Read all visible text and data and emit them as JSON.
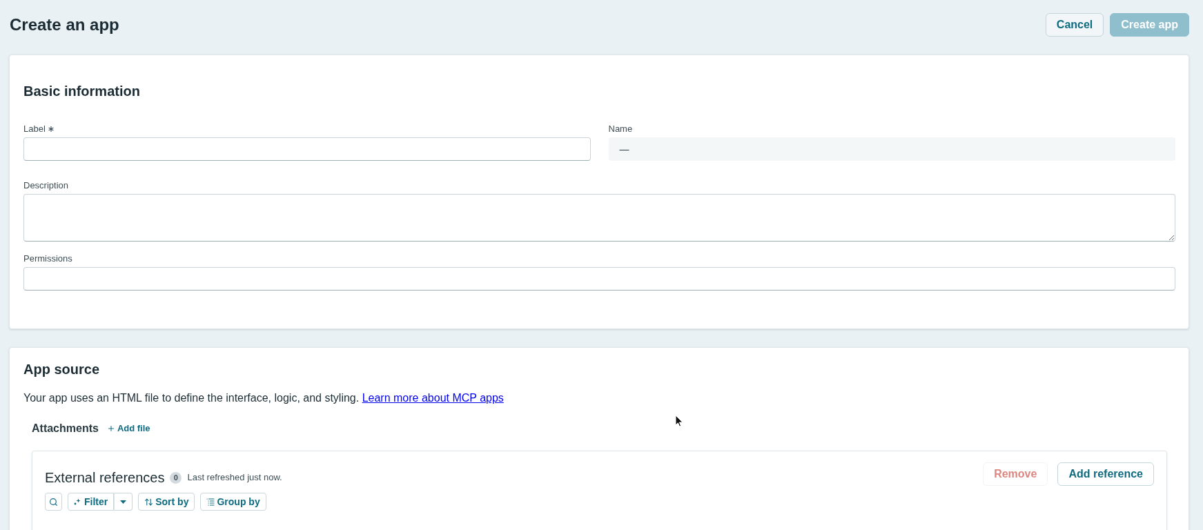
{
  "page": {
    "title": "Create an app"
  },
  "header_actions": [
    {
      "label": "Cancel",
      "kind": "secondary",
      "disabled": false
    },
    {
      "label": "Create app",
      "kind": "primary",
      "disabled": true
    }
  ],
  "basic_information": {
    "title": "Basic information",
    "rows": [
      [
        {
          "label": "Label",
          "kind": "input",
          "required": true
        },
        {
          "label": "Name",
          "kind": "readonly",
          "required": false,
          "value": "—"
        }
      ],
      [
        {
          "label": "Description",
          "kind": "textarea",
          "required": false
        }
      ],
      [
        {
          "label": "Permissions",
          "kind": "input",
          "required": false
        }
      ]
    ]
  },
  "app_source": {
    "title": "App source",
    "intro": "Your app uses an HTML file to define the interface, logic, and styling.",
    "link": "Learn more about MCP apps",
    "attachments": {
      "label": "Attachments",
      "add_button": "Add file"
    },
    "external_references": {
      "title": "External references",
      "count": "0",
      "refreshed": "Last refreshed just now.",
      "actions": [
        {
          "label": "Remove",
          "kind": "danger",
          "disabled": true
        },
        {
          "label": "Add reference",
          "kind": "secondary",
          "disabled": false
        }
      ],
      "toolbar": [
        {
          "kind": "search"
        },
        {
          "kind": "filter",
          "label": "Filter"
        },
        {
          "kind": "sort",
          "label": "Sort by"
        },
        {
          "kind": "group",
          "label": "Group by"
        }
      ]
    }
  }
}
